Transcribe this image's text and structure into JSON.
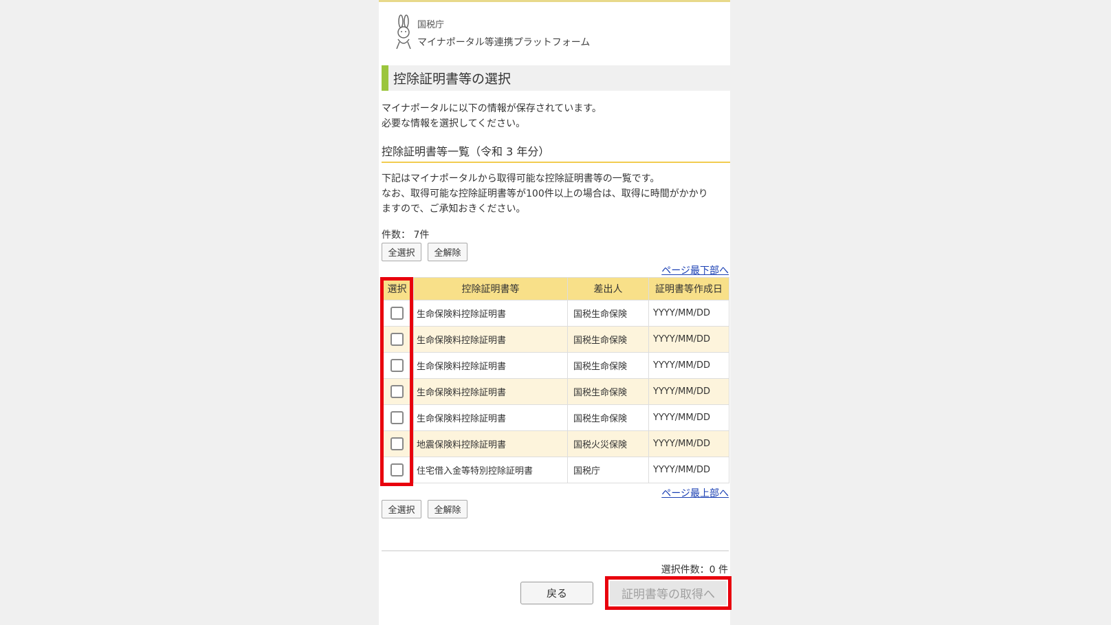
{
  "header": {
    "agency": "国税庁",
    "platform": "マイナポータル等連携プラットフォーム"
  },
  "page_title": "控除証明書等の選択",
  "intro": {
    "line1": "マイナポータルに以下の情報が保存されています。",
    "line2": "必要な情報を選択してください。"
  },
  "list_heading": "控除証明書等一覧（令和 3 年分）",
  "description": {
    "line1": "下記はマイナポータルから取得可能な控除証明書等の一覧です。",
    "line2": "なお、取得可能な控除証明書等が100件以上の場合は、取得に時間がかかり",
    "line3": "ますので、ご承知おきください。"
  },
  "count_label": "件数： 7件",
  "buttons": {
    "select_all": "全選択",
    "deselect_all": "全解除",
    "back": "戻る",
    "get_certificates": "証明書等の取得へ"
  },
  "links": {
    "to_bottom": "ページ最下部へ",
    "to_top": "ページ最上部へ"
  },
  "table": {
    "headers": [
      "選択",
      "控除証明書等",
      "差出人",
      "証明書等作成日"
    ],
    "rows": [
      {
        "doc": "生命保険料控除証明書",
        "sender": "国税生命保険",
        "date": "YYYY/MM/DD",
        "checked": false
      },
      {
        "doc": "生命保険料控除証明書",
        "sender": "国税生命保険",
        "date": "YYYY/MM/DD",
        "checked": false
      },
      {
        "doc": "生命保険料控除証明書",
        "sender": "国税生命保険",
        "date": "YYYY/MM/DD",
        "checked": false
      },
      {
        "doc": "生命保険料控除証明書",
        "sender": "国税生命保険",
        "date": "YYYY/MM/DD",
        "checked": false
      },
      {
        "doc": "生命保険料控除証明書",
        "sender": "国税生命保険",
        "date": "YYYY/MM/DD",
        "checked": false
      },
      {
        "doc": "地震保険料控除証明書",
        "sender": "国税火災保険",
        "date": "YYYY/MM/DD",
        "checked": false
      },
      {
        "doc": "住宅借入金等特別控除証明書",
        "sender": "国税庁",
        "date": "YYYY/MM/DD",
        "checked": false
      }
    ]
  },
  "selected_count": "選択件数：0 件",
  "colors": {
    "accent_green": "#9bc53d",
    "header_yellow": "#f8e089",
    "row_alt": "#fdf4dc",
    "highlight_red": "#e8000d",
    "link_blue": "#1a3fb3"
  },
  "icons": {
    "logo": "rabbit-mascot-icon"
  }
}
